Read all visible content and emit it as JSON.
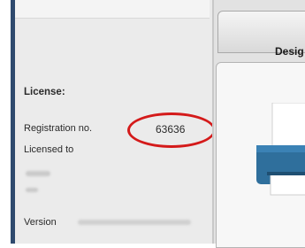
{
  "license_panel": {
    "heading": "License:",
    "registration_label": "Registration no.",
    "registration_value": "63636",
    "licensed_to_label": "Licensed to",
    "version_label": "Version"
  },
  "tabs": [
    {
      "label": "Desig"
    }
  ],
  "colors": {
    "highlight_ring": "#d41a1a",
    "left_border": "#2f4a6e",
    "printer_body": "#2f6f9c"
  },
  "icons": {
    "printer": "printer-icon"
  }
}
